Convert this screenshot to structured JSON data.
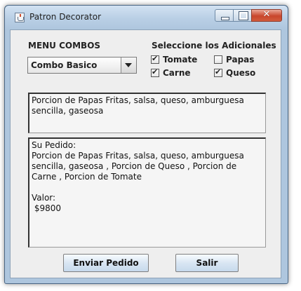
{
  "window": {
    "title": "Patron Decorator"
  },
  "window_controls": {
    "close": "✕"
  },
  "menu": {
    "label": "MENU COMBOS",
    "selected": "Combo Basico"
  },
  "adicionales": {
    "label": "Seleccione los Adicionales",
    "items": [
      {
        "label": "Tomate",
        "checked": true
      },
      {
        "label": "Papas",
        "checked": false
      },
      {
        "label": "Carne",
        "checked": true
      },
      {
        "label": "Queso",
        "checked": true
      }
    ]
  },
  "description": "Porcion de Papas Fritas, salsa, queso, amburguesa\nsencilla, gaseosa",
  "order": "Su Pedido:\nPorcion de Papas Fritas, salsa, queso, amburguesa\nsencilla, gaseosa , Porcion de Queso , Porcion de\nCarne , Porcion de Tomate\n\nValor:\n $9800",
  "buttons": {
    "send": "Enviar Pedido",
    "exit": "Salir"
  }
}
